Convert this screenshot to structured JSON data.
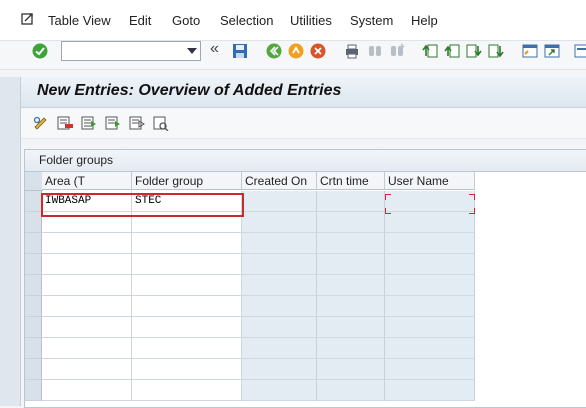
{
  "menubar": {
    "items": [
      "Table View",
      "Edit",
      "Goto",
      "Selection",
      "Utilities",
      "System",
      "Help"
    ]
  },
  "toolbar": {
    "command_field_value": "",
    "command_field_placeholder": "",
    "nav_glyph": "«",
    "buttons": [
      "enter-icon",
      "save-icon",
      "back-icon",
      "exit-icon",
      "cancel-icon",
      "print-icon",
      "find-icon",
      "find-next-icon",
      "first-page-icon",
      "previous-page-icon",
      "next-page-icon",
      "last-page-icon",
      "create-session-icon",
      "shortcut-icon"
    ]
  },
  "page": {
    "title": "New Entries: Overview of Added Entries"
  },
  "app_toolbar": {
    "buttons": [
      "change-display-icon",
      "delete-icon",
      "select-all-icon",
      "select-block-icon",
      "deselect-all-icon",
      "field-attributes-icon"
    ]
  },
  "panel": {
    "title": "Folder groups",
    "columns": [
      "Area (T",
      "Folder group",
      "Created On",
      "Crtn time",
      "User Name"
    ],
    "rows": [
      [
        "IWBASAP",
        "STEC",
        "",
        "",
        ""
      ],
      [
        "",
        "",
        "",
        "",
        ""
      ],
      [
        "",
        "",
        "",
        "",
        ""
      ],
      [
        "",
        "",
        "",
        "",
        ""
      ],
      [
        "",
        "",
        "",
        "",
        ""
      ],
      [
        "",
        "",
        "",
        "",
        ""
      ],
      [
        "",
        "",
        "",
        "",
        ""
      ],
      [
        "",
        "",
        "",
        "",
        ""
      ],
      [
        "",
        "",
        "",
        "",
        ""
      ],
      [
        "",
        "",
        "",
        "",
        ""
      ]
    ]
  },
  "colors": {
    "highlight": "#c92a2a",
    "readonly_cell": "#e3ebf3",
    "title_bar": "#dde6ef"
  }
}
